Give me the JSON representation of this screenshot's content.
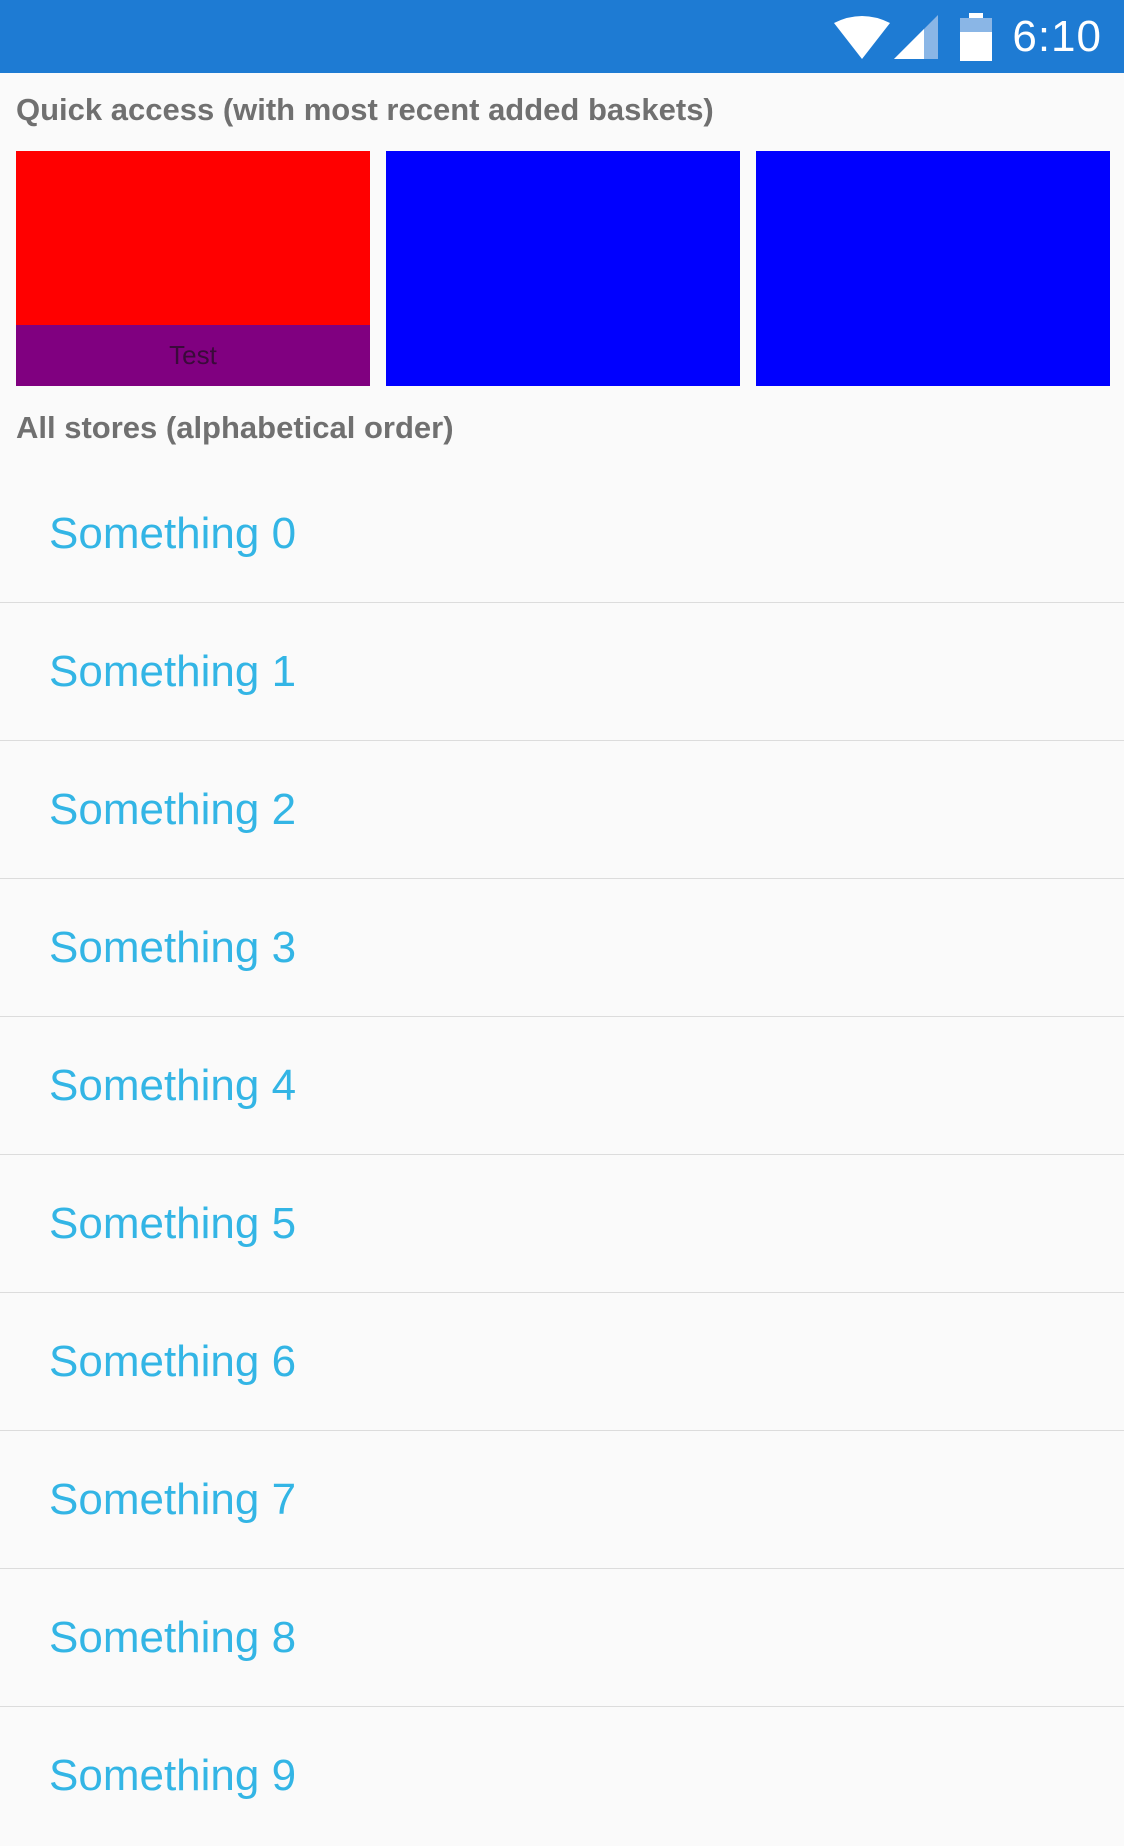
{
  "status_bar": {
    "time": "6:10",
    "background": "#1e7bd3",
    "icons": [
      "wifi-icon",
      "signal-icon",
      "battery-icon"
    ]
  },
  "quick_access": {
    "title": "Quick access (with most recent added baskets)",
    "tiles": [
      {
        "color": "#ff0000",
        "caption": "Test",
        "caption_color": "#800080"
      },
      {
        "color": "#0000ff",
        "caption": ""
      },
      {
        "color": "#0000ff",
        "caption": ""
      }
    ]
  },
  "stores": {
    "title": "All stores (alphabetical order)",
    "text_color": "#33b5e5",
    "items": [
      "Something 0",
      "Something 1",
      "Something 2",
      "Something 3",
      "Something 4",
      "Something 5",
      "Something 6",
      "Something 7",
      "Something 8",
      "Something 9"
    ]
  }
}
